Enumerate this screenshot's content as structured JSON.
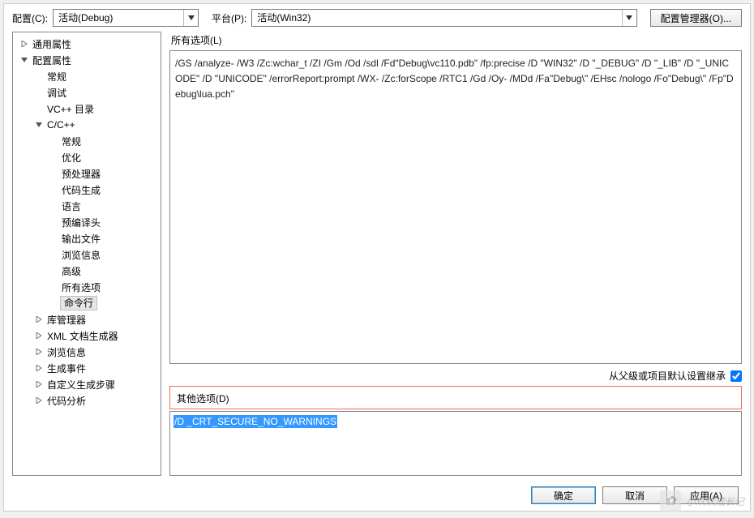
{
  "topbar": {
    "config_label": "配置(C):",
    "config_value": "活动(Debug)",
    "platform_label": "平台(P):",
    "platform_value": "活动(Win32)",
    "config_manager_label": "配置管理器(O)..."
  },
  "tree": [
    {
      "label": "通用属性",
      "depth": 0,
      "toggle": "right",
      "selected": false
    },
    {
      "label": "配置属性",
      "depth": 0,
      "toggle": "down",
      "selected": false
    },
    {
      "label": "常规",
      "depth": 1,
      "toggle": "none",
      "selected": false
    },
    {
      "label": "调试",
      "depth": 1,
      "toggle": "none",
      "selected": false
    },
    {
      "label": "VC++ 目录",
      "depth": 1,
      "toggle": "none",
      "selected": false
    },
    {
      "label": "C/C++",
      "depth": 1,
      "toggle": "down",
      "selected": false
    },
    {
      "label": "常规",
      "depth": 2,
      "toggle": "none",
      "selected": false
    },
    {
      "label": "优化",
      "depth": 2,
      "toggle": "none",
      "selected": false
    },
    {
      "label": "预处理器",
      "depth": 2,
      "toggle": "none",
      "selected": false
    },
    {
      "label": "代码生成",
      "depth": 2,
      "toggle": "none",
      "selected": false
    },
    {
      "label": "语言",
      "depth": 2,
      "toggle": "none",
      "selected": false
    },
    {
      "label": "预编译头",
      "depth": 2,
      "toggle": "none",
      "selected": false
    },
    {
      "label": "输出文件",
      "depth": 2,
      "toggle": "none",
      "selected": false
    },
    {
      "label": "浏览信息",
      "depth": 2,
      "toggle": "none",
      "selected": false
    },
    {
      "label": "高级",
      "depth": 2,
      "toggle": "none",
      "selected": false
    },
    {
      "label": "所有选项",
      "depth": 2,
      "toggle": "none",
      "selected": false
    },
    {
      "label": "命令行",
      "depth": 2,
      "toggle": "none",
      "selected": true
    },
    {
      "label": "库管理器",
      "depth": 1,
      "toggle": "right",
      "selected": false
    },
    {
      "label": "XML 文档生成器",
      "depth": 1,
      "toggle": "right",
      "selected": false
    },
    {
      "label": "浏览信息",
      "depth": 1,
      "toggle": "right",
      "selected": false
    },
    {
      "label": "生成事件",
      "depth": 1,
      "toggle": "right",
      "selected": false
    },
    {
      "label": "自定义生成步骤",
      "depth": 1,
      "toggle": "right",
      "selected": false
    },
    {
      "label": "代码分析",
      "depth": 1,
      "toggle": "right",
      "selected": false
    }
  ],
  "right": {
    "all_options_label": "所有选项(L)",
    "all_options_text": "/GS /analyze- /W3 /Zc:wchar_t /ZI /Gm /Od /sdl /Fd\"Debug\\vc110.pdb\" /fp:precise /D \"WIN32\" /D \"_DEBUG\" /D \"_LIB\" /D \"_UNICODE\" /D \"UNICODE\" /errorReport:prompt /WX- /Zc:forScope /RTC1 /Gd /Oy- /MDd /Fa\"Debug\\\" /EHsc /nologo /Fo\"Debug\\\" /Fp\"Debug\\lua.pch\"",
    "inherit_label": "从父级或项目默认设置继承",
    "inherit_checked": true,
    "other_options_label": "其他选项(D)",
    "other_options_value": "/D _CRT_SECURE_NO_WARNINGS"
  },
  "buttons": {
    "ok": "确定",
    "cancel": "取消",
    "apply": "应用(A)"
  },
  "watermark": "小欢欢成长记"
}
